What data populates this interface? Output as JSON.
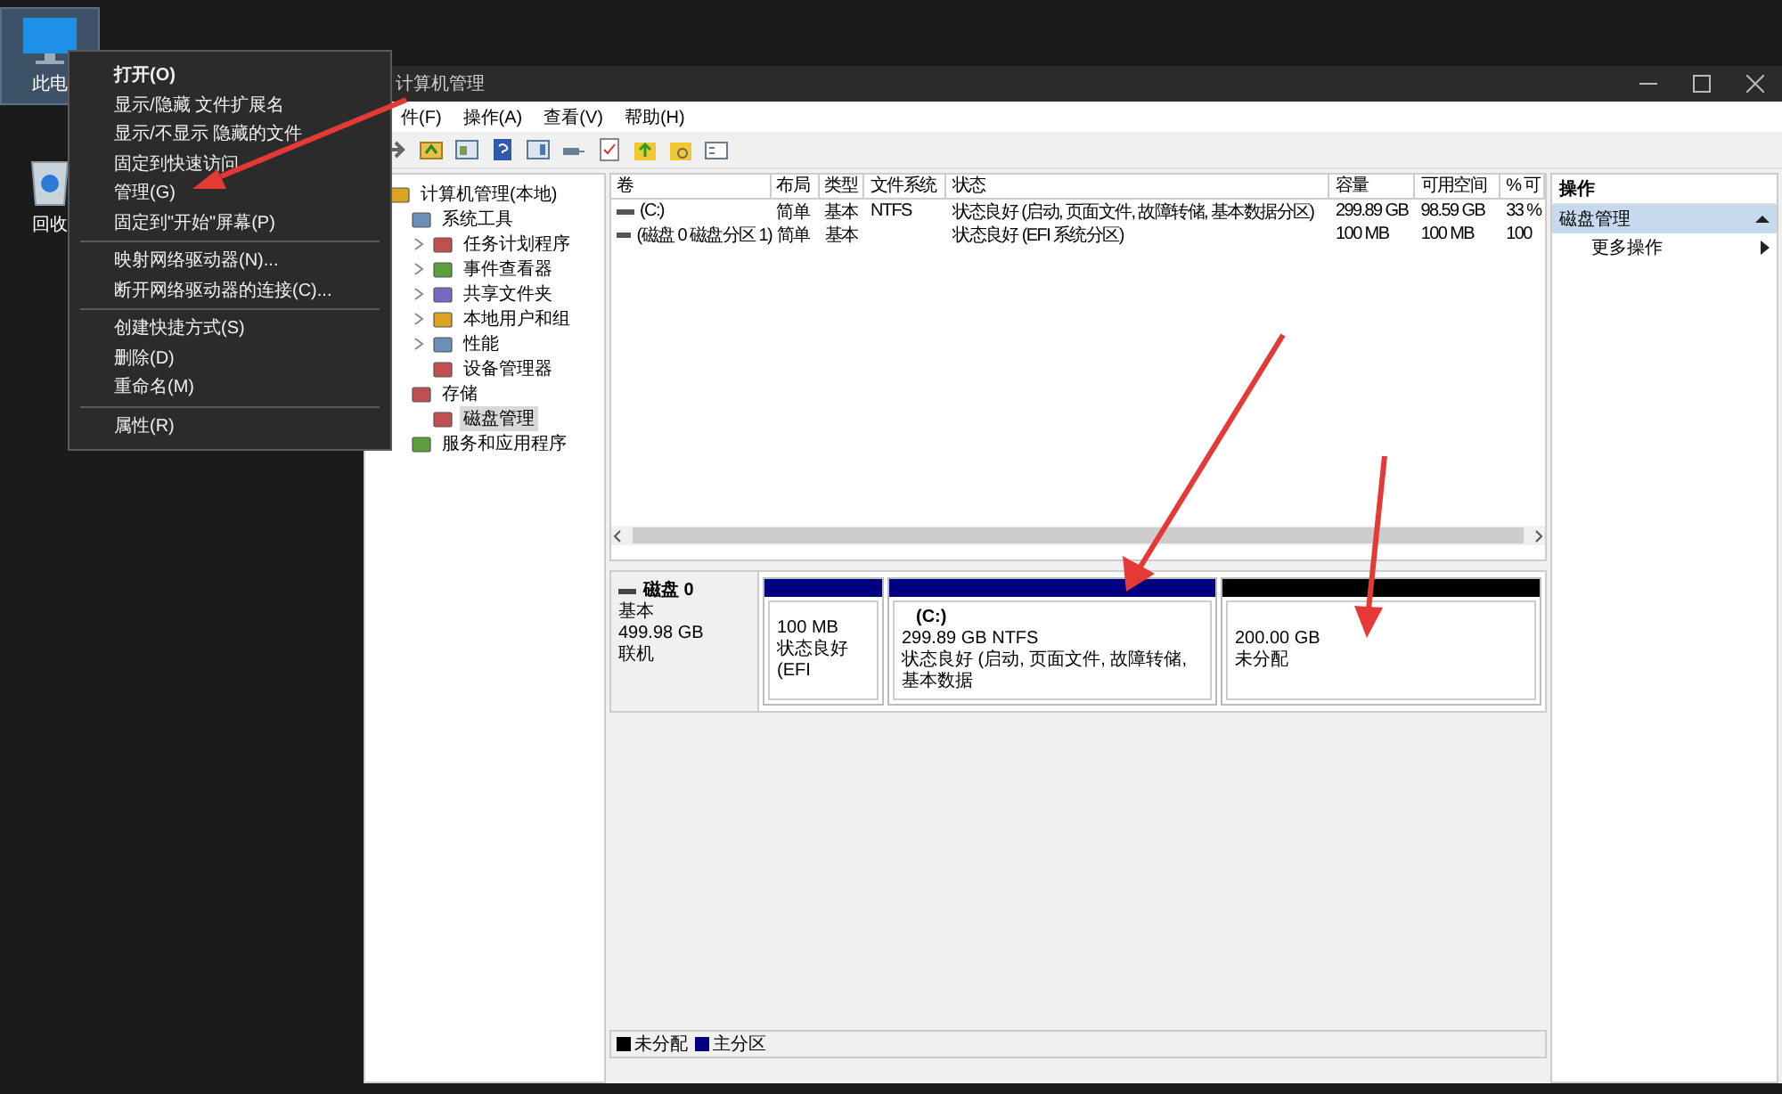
{
  "desktop_icons": [
    {
      "kind": "monitor",
      "label": "此电",
      "selected": true
    },
    {
      "kind": "bin",
      "label": "回收",
      "selected": false
    }
  ],
  "context_menu": {
    "groups": [
      [
        {
          "label": "打开(O)",
          "default": true
        },
        {
          "label": "显示/隐藏 文件扩展名",
          "default": false
        },
        {
          "label": "显示/不显示 隐藏的文件",
          "default": false
        },
        {
          "label": "固定到快速访问",
          "default": false
        },
        {
          "label": "管理(G)",
          "default": false
        },
        {
          "label": "固定到\"开始\"屏幕(P)",
          "default": false
        }
      ],
      [
        {
          "label": "映射网络驱动器(N)...",
          "default": false
        },
        {
          "label": "断开网络驱动器的连接(C)...",
          "default": false
        }
      ],
      [
        {
          "label": "创建快捷方式(S)",
          "default": false
        },
        {
          "label": "删除(D)",
          "default": false
        },
        {
          "label": "重命名(M)",
          "default": false
        }
      ],
      [
        {
          "label": "属性(R)",
          "default": false
        }
      ]
    ]
  },
  "window": {
    "title": "计算机管理"
  },
  "menu_bar": [
    "件(F)",
    "操作(A)",
    "查看(V)",
    "帮助(H)"
  ],
  "tree": [
    {
      "label": "计算机管理(本地)",
      "selected": false,
      "children": [
        {
          "label": "系统工具",
          "selected": false,
          "children": [
            {
              "label": "任务计划程序",
              "selected": false,
              "expanded": false
            },
            {
              "label": "事件查看器",
              "selected": false,
              "expanded": false
            },
            {
              "label": "共享文件夹",
              "selected": false,
              "expanded": false
            },
            {
              "label": "本地用户和组",
              "selected": false,
              "expanded": false
            },
            {
              "label": "性能",
              "selected": false,
              "expanded": false
            },
            {
              "label": "设备管理器",
              "selected": false
            }
          ]
        },
        {
          "label": "存储",
          "selected": false,
          "children": [
            {
              "label": "磁盘管理",
              "selected": true
            }
          ]
        },
        {
          "label": "服务和应用程序",
          "selected": false
        }
      ]
    }
  ],
  "table": {
    "columns": [
      "卷",
      "布局",
      "类型",
      "文件系统",
      "状态",
      "容量",
      "可用空间",
      "% 可"
    ],
    "rows": [
      {
        "volume": "(C:)",
        "layout": "简单",
        "type": "基本",
        "filesystem": "NTFS",
        "status": "状态良好 (启动, 页面文件, 故障转储, 基本数据分区)",
        "capacity": "299.89 GB",
        "free": "98.59 GB",
        "percent_free": "33 %"
      },
      {
        "volume": "(磁盘 0 磁盘分区 1)",
        "layout": "简单",
        "type": "基本",
        "status": "状态良好 (EFI 系统分区)",
        "capacity": "100 MB",
        "free": "100 MB",
        "percent_free": "100"
      }
    ]
  },
  "disk": {
    "name": "磁盘 0",
    "type": "基本",
    "size": "499.98 GB",
    "status": "联机",
    "partitions": [
      {
        "color": "#000080",
        "size": "100 MB",
        "status": "状态良好 (EFI"
      },
      {
        "color": "#000080",
        "label": "(C:)",
        "size": "299.89 GB NTFS",
        "status": "状态良好 (启动, 页面文件, 故障转储, 基本数据"
      },
      {
        "color": "#000000",
        "size": "200.00 GB",
        "status": "未分配"
      }
    ]
  },
  "legend": [
    {
      "color": "#000000",
      "label": "未分配"
    },
    {
      "color": "#000080",
      "label": "主分区"
    }
  ],
  "actions": {
    "title": "操作",
    "section": {
      "label": "磁盘管理",
      "expanded": true
    },
    "items": [
      "更多操作"
    ]
  }
}
